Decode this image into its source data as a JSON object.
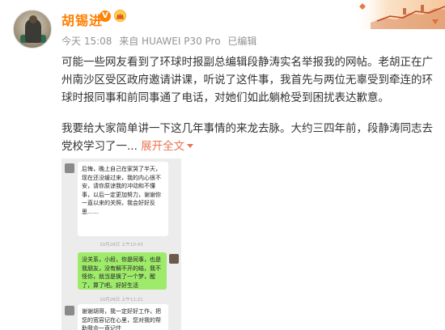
{
  "user": {
    "name": "胡锡进",
    "verified_badge": "V"
  },
  "meta": {
    "time": "今天 15:08",
    "source": "来自 HUAWEI P30 Pro",
    "edited": "已编辑"
  },
  "post": {
    "paragraph1": "可能一些网友看到了环球时报副总编辑段静涛实名举报我的网帖。老胡正在广州南沙区受区政府邀请讲课，听说了这件事，我首先与两位无辜受到牵连的环球时报同事和前同事通了电话，对她们如此躺枪受到困扰表达歉意。",
    "paragraph2": "我要给大家简单讲一下这几年事情的来龙去脉。大约三四年前，段静涛同志去党校学习了一",
    "ellipsis": "...",
    "expand_label": "展开全文"
  },
  "screenshot": {
    "bubble1": "后悔，晚上自己在家哭了半天，现在还没缓过来，我的内心很不安，请你原谅我的冲动和不懂事，以后一定更加努力，谢谢你一直以来的关照，我会好好反思……",
    "stamp1": "10月26日 上午10:43",
    "bubble2": "没关系，小段，你是同事，也是我朋友，没有解不开的结，我不怪你，就当是换了一个梦，醒了，算了吧。好好生活",
    "stamp2": "10月26日 上午11:21",
    "bubble3": "谢谢胡哥，我一定好好工作，把您的宽容记在心里，您对我的帮助我会一直记住"
  },
  "colors": {
    "name": "#ff7f00",
    "meta": "#939393",
    "expand": "#eb7350",
    "chat_green": "#9eea6a"
  },
  "icons": {
    "verified": "verified-v-badge",
    "crown": "crown-icon",
    "expand": "chevron-down-icon",
    "banner": "great-wall-banner"
  }
}
